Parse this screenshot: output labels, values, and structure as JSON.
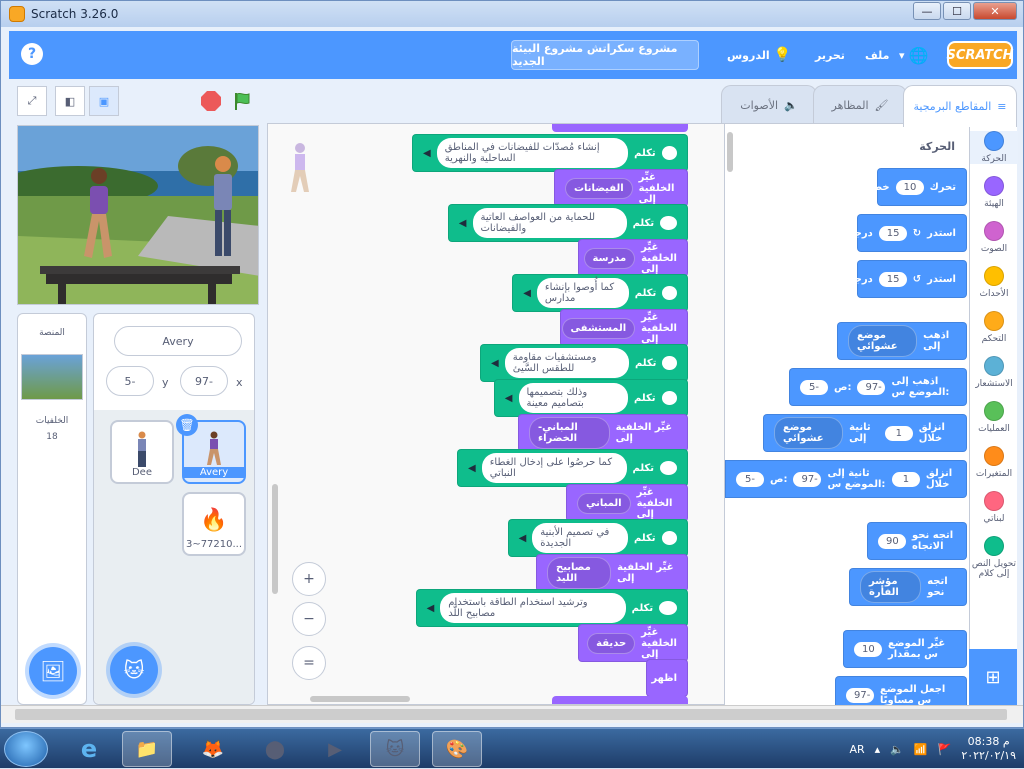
{
  "window": {
    "title": "Scratch 3.26.0",
    "buttons": [
      "—",
      "☐",
      "✕"
    ]
  },
  "menubar": {
    "logo": "SCRATCH",
    "items": {
      "file": "ملف",
      "edit": "تحرير",
      "tutorials": "الدروس"
    },
    "project_title": "مشروع سكراتش مشروع البيئة الجديد",
    "help": "?"
  },
  "tabs": {
    "code": "المقاطع البرمجية",
    "costumes": "المظاهر",
    "sounds": "الأصوات"
  },
  "sprite_info": {
    "name": "Avery",
    "x_label": "x",
    "x_value": "97-",
    "y_label": "y",
    "y_value": "5-"
  },
  "sprites": [
    {
      "name": "Dee"
    },
    {
      "name": "Avery"
    },
    {
      "name": "3~77210..."
    }
  ],
  "stage_panel": {
    "label": "المنصة",
    "backdrops_label": "الخلفيات",
    "backdrops_count": "18"
  },
  "categories": [
    {
      "label": "الحركة",
      "color": "#4c97ff"
    },
    {
      "label": "الهيئة",
      "color": "#9966ff"
    },
    {
      "label": "الصوت",
      "color": "#cf63cf"
    },
    {
      "label": "الأحداث",
      "color": "#ffbf00"
    },
    {
      "label": "التحكم",
      "color": "#ffab19"
    },
    {
      "label": "الاستشعار",
      "color": "#5cb1d6"
    },
    {
      "label": "العمليات",
      "color": "#59c059"
    },
    {
      "label": "المتغيرات",
      "color": "#ff8c1a"
    },
    {
      "label": "لبناتي",
      "color": "#ff6680"
    },
    {
      "label": "تحويل النص إلى كلام",
      "color": "#0fbd8c"
    }
  ],
  "palette": {
    "heading": "الحركة",
    "move": {
      "text": "تحرك",
      "value": "10",
      "suffix": "خطوة"
    },
    "turn_right": {
      "text": "استدر",
      "value": "15",
      "suffix": "درجة"
    },
    "turn_left": {
      "text": "استدر",
      "value": "15",
      "suffix": "درجة"
    },
    "goto_random": {
      "text": "اذهب إلى",
      "dropdown": "موضع عشوائي"
    },
    "goto_xy": {
      "text": "اذهب إلى الموضع س:",
      "x": "97-",
      "y_label": "ص:",
      "y": "5-"
    },
    "glide_random": {
      "text": "انزلق خلال",
      "value": "1",
      "mid": "ثانية إلى",
      "dropdown": "موضع عشوائي"
    },
    "glide_xy": {
      "text": "انزلق خلال",
      "value": "1",
      "mid": "ثانية إلى الموضع س:",
      "x": "97-",
      "y_label": "ص:",
      "y": "5-"
    },
    "point_dir": {
      "text": "اتجه نحو الاتجاه",
      "value": "90"
    },
    "point_towards": {
      "text": "اتجه نحو",
      "dropdown": "مؤشر الفأرة"
    },
    "change_x": {
      "text": "غيِّر الموضع س بمقدار",
      "value": "10"
    },
    "set_x": {
      "text": "اجعل الموضع س مساويًا",
      "value": "97-"
    }
  },
  "script": [
    {
      "type": "say",
      "label": "تكلم",
      "text": "إنشاء مُصدّات للفيضانات في المناطق الساحلية والنهرية"
    },
    {
      "type": "backdrop",
      "label": "غيِّر الخلفية إلى",
      "value": "الفيضانات"
    },
    {
      "type": "say",
      "label": "تكلم",
      "text": "للحماية من العواصف العاتية والفيضانات"
    },
    {
      "type": "backdrop",
      "label": "غيِّر الخلفية إلى",
      "value": "مدرسة"
    },
    {
      "type": "say",
      "label": "تكلم",
      "text": "كما أُوصوا بإنشاء مدارس"
    },
    {
      "type": "backdrop",
      "label": "غيِّر الخلفية إلى",
      "value": "المستشفى"
    },
    {
      "type": "say",
      "label": "تكلم",
      "text": "ومستشفيات مقاومة للطقس السَّيئ"
    },
    {
      "type": "say",
      "label": "تكلم",
      "text": "وذلك بتصميمها بتصاميم معينة"
    },
    {
      "type": "backdrop",
      "label": "غيِّر الخلفية إلى",
      "value": "المباني-الخضراء"
    },
    {
      "type": "say",
      "label": "تكلم",
      "text": "كما حرصُوا على إدخال الغطاء النباتي"
    },
    {
      "type": "backdrop",
      "label": "غيِّر الخلفية إلى",
      "value": "المباني"
    },
    {
      "type": "say",
      "label": "تكلم",
      "text": "في تصميم الأبنية الجديدة"
    },
    {
      "type": "backdrop",
      "label": "غيِّر الخلفية إلى",
      "value": "مصابيح الليد"
    },
    {
      "type": "say",
      "label": "تكلم",
      "text": "وترشيد استخدام الطاقة باستخدام مصابيح اللَّد"
    },
    {
      "type": "backdrop",
      "label": "غيِّر الخلفية إلى",
      "value": "حديقة"
    },
    {
      "type": "show",
      "label": "اظهر"
    }
  ],
  "zoom": {
    "in": "+",
    "out": "−",
    "reset": "="
  },
  "taskbar": {
    "lang": "AR",
    "time": "08:38 م",
    "date": "٢٠٢٢/٠٢/١٩"
  }
}
